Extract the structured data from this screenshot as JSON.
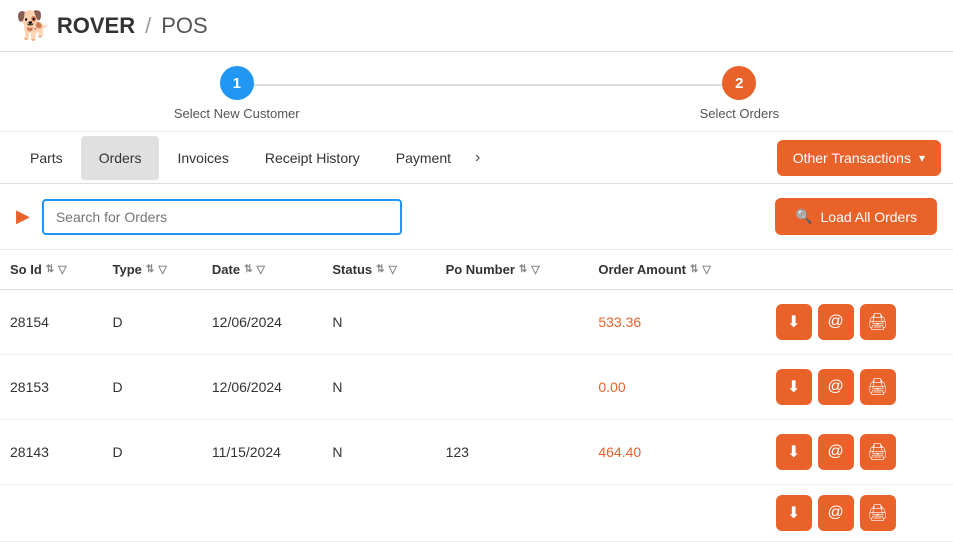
{
  "header": {
    "logo_icon": "🐕",
    "logo_text": "ROVER",
    "separator": "/",
    "logo_sub": "POS"
  },
  "stepper": {
    "steps": [
      {
        "id": 1,
        "label": "Select New Customer",
        "color": "blue"
      },
      {
        "id": 2,
        "label": "Select Orders",
        "color": "orange"
      }
    ],
    "line_color": "#ddd"
  },
  "tabs": {
    "items": [
      {
        "label": "Parts",
        "active": false
      },
      {
        "label": "Orders",
        "active": true
      },
      {
        "label": "Invoices",
        "active": false
      },
      {
        "label": "Receipt History",
        "active": false
      },
      {
        "label": "Payment",
        "active": false
      }
    ],
    "more_icon": "›",
    "other_transactions_label": "Other Transactions",
    "chevron": "▾"
  },
  "search": {
    "play_icon": "▶",
    "placeholder": "Search for Orders",
    "load_button_label": "Load All Orders",
    "search_icon": "🔍"
  },
  "table": {
    "columns": [
      {
        "key": "so_id",
        "label": "So Id"
      },
      {
        "key": "type",
        "label": "Type"
      },
      {
        "key": "date",
        "label": "Date"
      },
      {
        "key": "status",
        "label": "Status"
      },
      {
        "key": "po_number",
        "label": "Po Number"
      },
      {
        "key": "order_amount",
        "label": "Order Amount"
      },
      {
        "key": "actions",
        "label": ""
      }
    ],
    "rows": [
      {
        "so_id": "28154",
        "type": "D",
        "date": "12/06/2024",
        "status": "N",
        "po_number": "",
        "order_amount": "533.36"
      },
      {
        "so_id": "28153",
        "type": "D",
        "date": "12/06/2024",
        "status": "N",
        "po_number": "",
        "order_amount": "0.00"
      },
      {
        "so_id": "28143",
        "type": "D",
        "date": "11/15/2024",
        "status": "N",
        "po_number": "123",
        "order_amount": "464.40"
      }
    ],
    "action_buttons": [
      {
        "icon": "⬇",
        "name": "download"
      },
      {
        "icon": "@",
        "name": "email"
      },
      {
        "icon": "🖨",
        "name": "print"
      }
    ]
  }
}
